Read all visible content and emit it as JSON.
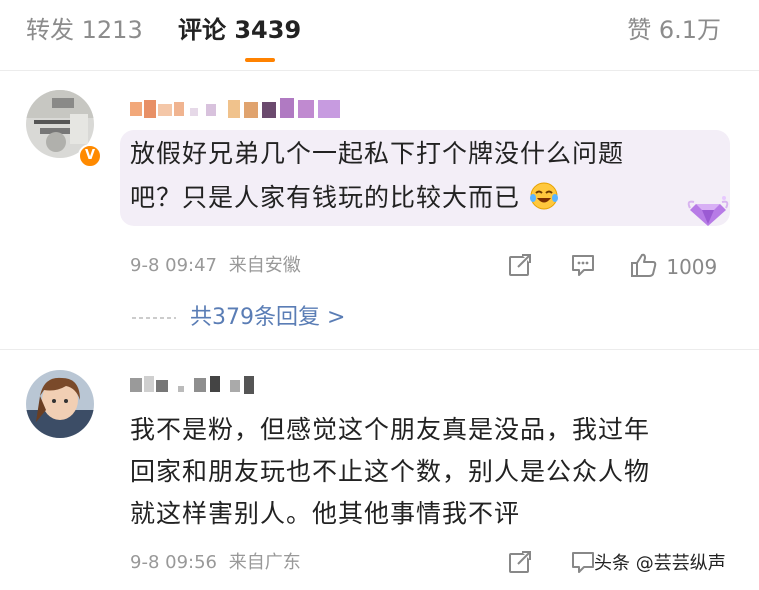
{
  "tabs": {
    "repost_label": "转发",
    "repost_count": "1213",
    "comment_label": "评论",
    "comment_count": "3439",
    "like_label": "赞",
    "like_count": "6.1万"
  },
  "comments": [
    {
      "text_line1": "放假好兄弟几个一起私下打个牌没什么问题",
      "text_line2": "吧？只是人家有钱玩的比较大而已",
      "emoji": "laugh-cry-emoji",
      "date": "9-8 09:47",
      "location": "来自安徽",
      "like_count": "1009",
      "reply_link": "共379条回复 >"
    },
    {
      "text_line1": "我不是粉，但感觉这个朋友真是没品，我过年",
      "text_line2": "回家和朋友玩也不止这个数，别人是公众人物",
      "text_line3": "就这样害别人。他其他事情我不评",
      "date": "9-8 09:56",
      "location": "来自广东"
    }
  ],
  "icons": [
    "share-icon",
    "comment-icon",
    "like-icon",
    "vip-badge-icon",
    "diamond-icon"
  ],
  "watermark": "头条 @芸芸纵声",
  "colors": {
    "accent": "#ff8200",
    "link": "#5a7db5",
    "bubble": "#f3eef7"
  }
}
